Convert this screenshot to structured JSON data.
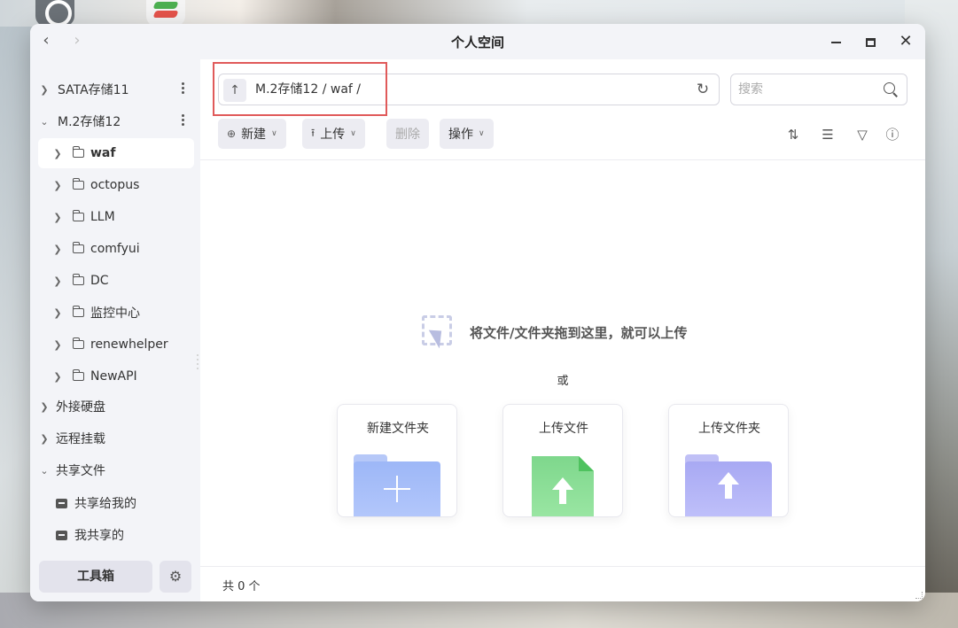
{
  "window": {
    "title": "个人空间"
  },
  "nav": {
    "back_icon": "chevron-left-icon",
    "forward_icon": "chevron-right-icon"
  },
  "window_controls": [
    "minimize",
    "maximize",
    "close"
  ],
  "sidebar": {
    "items": [
      {
        "label": "SATA存储11",
        "level": 0,
        "expanded": false
      },
      {
        "label": "M.2存储12",
        "level": 0,
        "expanded": true
      },
      {
        "label": "waf",
        "level": 1,
        "selected": true
      },
      {
        "label": "octopus",
        "level": 1
      },
      {
        "label": "LLM",
        "level": 1
      },
      {
        "label": "comfyui",
        "level": 1
      },
      {
        "label": "DC",
        "level": 1
      },
      {
        "label": "监控中心",
        "level": 1
      },
      {
        "label": "renewhelper",
        "level": 1
      },
      {
        "label": "NewAPI",
        "level": 1
      },
      {
        "label": "外接硬盘",
        "level": 0,
        "expanded": false
      },
      {
        "label": "远程挂载",
        "level": 0,
        "expanded": false
      },
      {
        "label": "共享文件",
        "level": 0,
        "expanded": true
      },
      {
        "label": "共享给我的",
        "level": 1
      },
      {
        "label": "我共享的",
        "level": 1
      }
    ],
    "toolbox_label": "工具箱"
  },
  "pathbar": {
    "path": "M.2存储12 / waf /"
  },
  "search": {
    "placeholder": "搜索"
  },
  "toolbar": {
    "new_label": "新建",
    "upload_label": "上传",
    "delete_label": "删除",
    "actions_label": "操作"
  },
  "empty_state": {
    "hint": "将文件/文件夹拖到这里，就可以上传",
    "or": "或",
    "cards": [
      {
        "label": "新建文件夹"
      },
      {
        "label": "上传文件"
      },
      {
        "label": "上传文件夹"
      }
    ]
  },
  "status": {
    "count_text": "共 0 个"
  },
  "colors": {
    "highlight_box": "#e05a5a",
    "folder_blue": "#9db7f7",
    "file_green": "#7ed78c",
    "folder_purple": "#a8a9f3"
  }
}
